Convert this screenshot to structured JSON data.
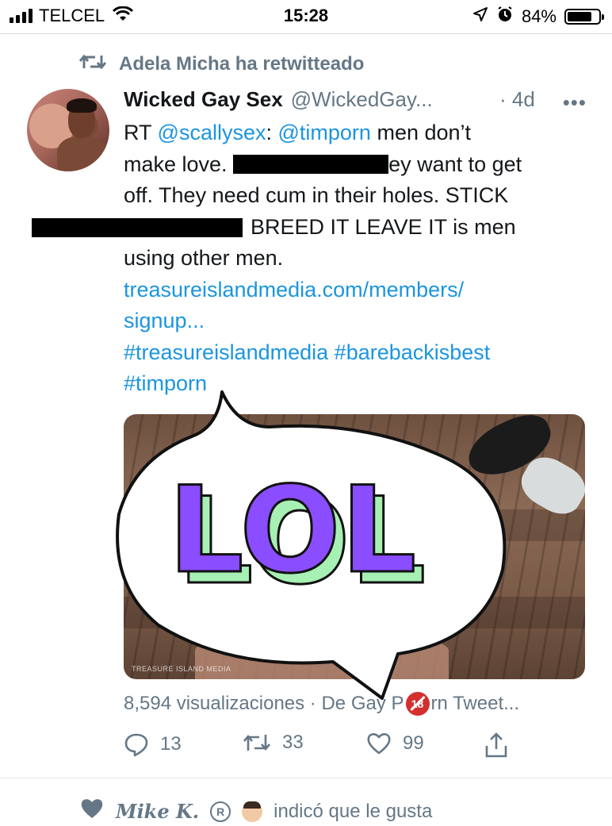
{
  "status_bar": {
    "carrier": "TELCEL",
    "time": "15:28",
    "battery_percent": "84%",
    "battery_level": 0.84,
    "icons": [
      "signal-icon",
      "wifi-icon",
      "location-icon",
      "alarm-icon",
      "battery-icon"
    ]
  },
  "retweet_context": {
    "icon": "retweet-icon",
    "text": "Adela Micha ha retwitteado"
  },
  "tweet": {
    "display_name": "Wicked Gay Sex",
    "handle": "@WickedGay...",
    "timestamp": "· 4d",
    "more": "•••",
    "body": {
      "rt_prefix": "RT ",
      "mention_scallysex": "@scallysex",
      "colon": ": ",
      "mention_timporn": "@timporn",
      "line1_rest": " men don’t",
      "line2_a": "make love. ",
      "line2_b": "ey want to get",
      "line3": "off. They need cum in their holes. STICK",
      "line4": "BREED IT LEAVE IT is men",
      "line5": "using other men.",
      "link_line1": "treasureislandmedia.com/members/",
      "link_line2": "signup...",
      "hashtag1": "#treasureislandmedia",
      "hashtag2": "#barebackisbest",
      "hashtag3": "#timporn"
    },
    "media": {
      "sticker_text": "LOL",
      "watermark": "TREASURE ISLAND MEDIA"
    },
    "views": {
      "count_text": "8,594 visualizaciones · De Gay P",
      "badge": "18",
      "rest": "rn Tweet..."
    },
    "actions": {
      "reply_count": "13",
      "retweet_count": "33",
      "like_count": "99"
    },
    "colors": {
      "link": "#1b95e0",
      "secondary": "#657786",
      "sticker_purple": "#8a4dff",
      "sticker_green": "#a6f0b4"
    }
  },
  "next_item": {
    "icon": "heart-icon",
    "name": "Mike K.",
    "registered": "R",
    "text": "indicó que le gusta"
  }
}
